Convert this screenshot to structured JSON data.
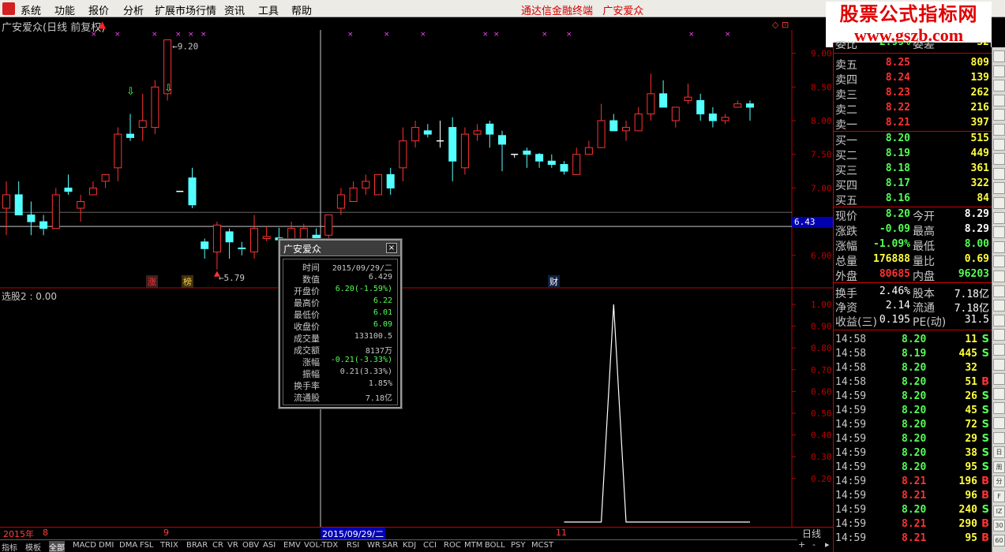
{
  "menu": {
    "items": [
      "系统",
      "功能",
      "报价",
      "分析",
      "扩展市场行情",
      "资讯",
      "工具",
      "帮助"
    ],
    "center_title": "通达信金融终端",
    "stock_title": "广安爱众"
  },
  "brand": {
    "line1": "股票公式指标网",
    "line2": "www.gszb.com"
  },
  "chart": {
    "title": "广安爱众(日线 前复权)",
    "high_label": "9.20",
    "low_label": "5.79",
    "price_ticks": [
      "9.00",
      "8.50",
      "8.00",
      "7.50",
      "7.00",
      "6.00"
    ],
    "crosshair_price": "6.43",
    "markers": {
      "zhang": "涨",
      "bang": "榜",
      "cai": "财"
    },
    "colors": {
      "up": "#ff3232",
      "down": "#54ffff",
      "flat": "#ffffff",
      "axis": "#c00000"
    }
  },
  "chart_data": {
    "type": "candlestick",
    "title": "广安爱众(日线 前复权)",
    "ohlc": [
      [
        6.7,
        7.1,
        6.3,
        6.9
      ],
      [
        6.9,
        7.1,
        6.7,
        6.6
      ],
      [
        6.6,
        6.8,
        6.3,
        6.5
      ],
      [
        6.5,
        6.6,
        6.3,
        6.4
      ],
      [
        6.4,
        7.0,
        6.4,
        6.9
      ],
      [
        7.0,
        7.2,
        6.9,
        6.95
      ],
      [
        6.7,
        6.9,
        6.5,
        6.8
      ],
      [
        6.9,
        7.1,
        6.9,
        7.0
      ],
      [
        7.1,
        7.2,
        7.0,
        7.2
      ],
      [
        7.3,
        7.9,
        7.1,
        7.8
      ],
      [
        7.8,
        8.1,
        7.7,
        7.75
      ],
      [
        7.9,
        8.4,
        7.7,
        8.0
      ],
      [
        7.9,
        8.6,
        7.8,
        8.5
      ],
      [
        8.4,
        9.2,
        8.3,
        9.2
      ],
      [
        6.95,
        6.95,
        6.95,
        6.95
      ],
      [
        7.15,
        7.3,
        6.7,
        6.75
      ],
      [
        6.2,
        6.25,
        5.95,
        6.1
      ],
      [
        6.05,
        6.5,
        5.79,
        6.45
      ],
      [
        6.35,
        6.4,
        5.95,
        6.2
      ],
      [
        6.11,
        6.2,
        6.0,
        6.1
      ],
      [
        6.05,
        6.6,
        5.95,
        6.4
      ],
      [
        6.25,
        6.43,
        6.21,
        6.28
      ],
      [
        6.26,
        6.41,
        6.14,
        6.23
      ],
      [
        6.1,
        6.5,
        6.05,
        6.4
      ],
      [
        6.16,
        6.47,
        6.16,
        6.4
      ],
      [
        6.3,
        6.4,
        6.0,
        6.1
      ],
      [
        6.3,
        6.6,
        6.2,
        6.6
      ],
      [
        6.7,
        7.0,
        6.6,
        6.9
      ],
      [
        6.8,
        7.1,
        6.8,
        7.0
      ],
      [
        7.0,
        7.2,
        6.9,
        7.1
      ],
      [
        6.9,
        7.2,
        6.9,
        7.2
      ],
      [
        7.2,
        7.3,
        6.9,
        7.0
      ],
      [
        7.3,
        7.9,
        7.1,
        7.7
      ],
      [
        7.7,
        8.0,
        7.6,
        7.9
      ],
      [
        7.85,
        7.95,
        7.75,
        7.8
      ],
      [
        7.7,
        8.0,
        7.6,
        7.7
      ],
      [
        7.9,
        8.05,
        7.1,
        7.4
      ],
      [
        7.3,
        7.9,
        7.2,
        7.8
      ],
      [
        7.8,
        7.95,
        7.7,
        7.85
      ],
      [
        7.95,
        8.0,
        7.6,
        7.8
      ],
      [
        7.78,
        7.85,
        7.25,
        7.65
      ],
      [
        7.5,
        7.5,
        7.45,
        7.5
      ],
      [
        7.55,
        7.6,
        7.3,
        7.5
      ],
      [
        7.5,
        7.52,
        7.3,
        7.4
      ],
      [
        7.4,
        7.5,
        7.3,
        7.35
      ],
      [
        7.35,
        7.4,
        7.2,
        7.25
      ],
      [
        7.2,
        7.6,
        7.2,
        7.5
      ],
      [
        7.5,
        7.7,
        7.5,
        7.6
      ],
      [
        7.6,
        8.25,
        7.6,
        8.0
      ],
      [
        8.0,
        8.1,
        7.9,
        7.85
      ],
      [
        7.85,
        8.0,
        7.7,
        7.9
      ],
      [
        7.85,
        8.2,
        7.85,
        8.1
      ],
      [
        8.1,
        8.7,
        8.0,
        8.4
      ],
      [
        8.4,
        8.6,
        8.2,
        8.2
      ],
      [
        8.0,
        8.2,
        7.9,
        8.2
      ],
      [
        8.3,
        8.55,
        8.25,
        8.35
      ],
      [
        8.3,
        8.4,
        8.0,
        8.1
      ],
      [
        8.1,
        8.2,
        7.9,
        8.0
      ],
      [
        8.0,
        8.1,
        7.95,
        8.05
      ],
      [
        8.2,
        8.3,
        8.2,
        8.25
      ],
      [
        8.25,
        8.3,
        8.0,
        8.2
      ]
    ],
    "ylim": [
      5.6,
      9.3
    ],
    "x_labels": [
      "2015年",
      "8",
      "9",
      "10",
      "11"
    ],
    "indicator": {
      "name": "选股2",
      "value": "0.00",
      "ticks": [
        "1.00",
        "0.90",
        "0.80",
        "0.70",
        "0.60",
        "0.50",
        "0.40",
        "0.30",
        "0.20"
      ],
      "signal_bars": [
        49,
        62
      ]
    }
  },
  "tooltip": {
    "title": "广安爱众",
    "rows": [
      {
        "k": "时间",
        "v": "2015/09/29/二",
        "c": "#c8c8c8"
      },
      {
        "k": "数值",
        "v": "6.429",
        "c": "#c8c8c8"
      },
      {
        "k": "开盘价",
        "v": "6.20(-1.59%)",
        "c": "#54ff54"
      },
      {
        "k": "最高价",
        "v": "6.22",
        "c": "#54ff54"
      },
      {
        "k": "最低价",
        "v": "6.01",
        "c": "#54ff54"
      },
      {
        "k": "收盘价",
        "v": "6.09",
        "c": "#54ff54"
      },
      {
        "k": "成交量",
        "v": "133100.5",
        "c": "#c8c8c8"
      },
      {
        "k": "成交额",
        "v": "8137万",
        "c": "#c8c8c8"
      },
      {
        "k": "涨幅",
        "v": "-0.21(-3.33%)",
        "c": "#54ff54"
      },
      {
        "k": "振幅",
        "v": "0.21(3.33%)",
        "c": "#c8c8c8"
      },
      {
        "k": "换手率",
        "v": "1.85%",
        "c": "#c8c8c8"
      },
      {
        "k": "流通股",
        "v": "7.18亿",
        "c": "#c8c8c8"
      }
    ]
  },
  "indicator_panel": {
    "title": "选股2 : 0.00"
  },
  "time_axis": {
    "labels": [
      "2015年",
      "8",
      "9",
      "2015/09/29/二",
      "11"
    ],
    "period": "日线"
  },
  "tabs": [
    "指标",
    "模板",
    "全部",
    "MACD",
    "DMI",
    "DMA",
    "FSL",
    "TRIX",
    "BRAR",
    "CR",
    "VR",
    "OBV",
    "ASI",
    "EMV",
    "VOL-TDX",
    "RSI",
    "WR",
    "SAR",
    "KDJ",
    "CCI",
    "ROC",
    "MTM",
    "BOLL",
    "PSY",
    "MCST"
  ],
  "quote": {
    "wei": {
      "label": "委比",
      "value": "2.99%",
      "label2": "委差",
      "value2": "32"
    },
    "asks": [
      {
        "l": "卖五",
        "p": "8.25",
        "v": "809"
      },
      {
        "l": "卖四",
        "p": "8.24",
        "v": "139"
      },
      {
        "l": "卖三",
        "p": "8.23",
        "v": "262"
      },
      {
        "l": "卖二",
        "p": "8.22",
        "v": "216"
      },
      {
        "l": "卖一",
        "p": "8.21",
        "v": "397"
      }
    ],
    "bids": [
      {
        "l": "买一",
        "p": "8.20",
        "v": "515"
      },
      {
        "l": "买二",
        "p": "8.19",
        "v": "449"
      },
      {
        "l": "买三",
        "p": "8.18",
        "v": "361"
      },
      {
        "l": "买四",
        "p": "8.17",
        "v": "322"
      },
      {
        "l": "买五",
        "p": "8.16",
        "v": "84"
      }
    ],
    "stats": [
      {
        "l": "现价",
        "v": "8.20",
        "c": "#54ff54",
        "l2": "今开",
        "v2": "8.29",
        "c2": "#ffffff"
      },
      {
        "l": "涨跌",
        "v": "-0.09",
        "c": "#54ff54",
        "l2": "最高",
        "v2": "8.29",
        "c2": "#ffffff"
      },
      {
        "l": "涨幅",
        "v": "-1.09%",
        "c": "#54ff54",
        "l2": "最低",
        "v2": "8.00",
        "c2": "#54ff54"
      },
      {
        "l": "总量",
        "v": "176888",
        "c": "#ffff40",
        "l2": "量比",
        "v2": "0.69",
        "c2": "#ffff40"
      },
      {
        "l": "外盘",
        "v": "80685",
        "c": "#ff3232",
        "l2": "内盘",
        "v2": "96203",
        "c2": "#54ff54"
      }
    ],
    "finance": [
      {
        "l": "换手",
        "v": "2.46%",
        "l2": "股本",
        "v2": "7.18亿"
      },
      {
        "l": "净资",
        "v": "2.14",
        "l2": "流通",
        "v2": "7.18亿"
      },
      {
        "l": "收益(三)",
        "v": "0.195",
        "l2": "PE(动)",
        "v2": "31.5"
      }
    ],
    "ticks": [
      {
        "t": "14:58",
        "p": "8.20",
        "v": "11",
        "f": "S"
      },
      {
        "t": "14:58",
        "p": "8.19",
        "v": "445",
        "f": "S"
      },
      {
        "t": "14:58",
        "p": "8.20",
        "v": "32",
        "f": ""
      },
      {
        "t": "14:58",
        "p": "8.20",
        "v": "51",
        "f": "B"
      },
      {
        "t": "14:59",
        "p": "8.20",
        "v": "26",
        "f": "S"
      },
      {
        "t": "14:59",
        "p": "8.20",
        "v": "45",
        "f": "S"
      },
      {
        "t": "14:59",
        "p": "8.20",
        "v": "72",
        "f": "S"
      },
      {
        "t": "14:59",
        "p": "8.20",
        "v": "29",
        "f": "S"
      },
      {
        "t": "14:59",
        "p": "8.20",
        "v": "38",
        "f": "S"
      },
      {
        "t": "14:59",
        "p": "8.20",
        "v": "95",
        "f": "S"
      },
      {
        "t": "14:59",
        "p": "8.21",
        "v": "196",
        "f": "B"
      },
      {
        "t": "14:59",
        "p": "8.21",
        "v": "96",
        "f": "B"
      },
      {
        "t": "14:59",
        "p": "8.20",
        "v": "240",
        "f": "S"
      },
      {
        "t": "14:59",
        "p": "8.21",
        "v": "290",
        "f": "B"
      },
      {
        "t": "14:59",
        "p": "8.21",
        "v": "95",
        "f": "B"
      }
    ]
  },
  "right_toolbar": [
    "日",
    "周",
    "分",
    "F",
    "IZ",
    "30",
    "60"
  ],
  "zoom": {
    "plus": "+",
    "minus": "-"
  }
}
